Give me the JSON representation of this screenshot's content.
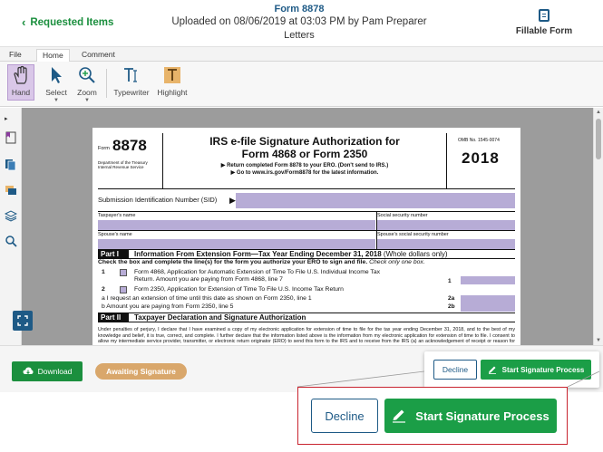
{
  "header": {
    "back_label": "Requested Items",
    "form_name": "Form 8878",
    "uploaded": "Uploaded on 08/06/2019 at 03:03 PM by Pam Preparer",
    "category": "Letters",
    "fillable_label": "Fillable Form"
  },
  "menubar": {
    "tabs": [
      "File",
      "Home",
      "Comment"
    ]
  },
  "toolbar": {
    "hand": "Hand",
    "select": "Select",
    "zoom": "Zoom",
    "typewriter": "Typewriter",
    "highlight": "Highlight"
  },
  "form": {
    "form_prefix": "Form",
    "form_number": "8878",
    "dept": "Department of the Treasury Internal Revenue Service",
    "title_line1": "IRS e-file Signature Authorization for",
    "title_line2": "Form 4868 or Form 2350",
    "instr1": "▶ Return completed Form 8878 to your ERO. (Don't send to IRS.)",
    "instr2": "▶ Go to www.irs.gov/Form8878 for the latest information.",
    "omb": "OMB No. 1545-0074",
    "year": "2018",
    "sid_label": "Submission Identification Number (SID)",
    "taxpayer_name": "Taxpayer's name",
    "ssn": "Social security number",
    "spouse_name": "Spouse's name",
    "spouse_ssn": "Spouse's social security number",
    "part1_label": "Part I",
    "part1_title": "Information From Extension Form—Tax Year Ending December 31, 2018",
    "part1_suffix": "(Whole dollars only)",
    "part1_instr": "Check the box and complete the line(s) for the form you authorize your ERO to sign and file.",
    "part1_instr_italic": "Check only one box.",
    "line1_no": "1",
    "line1_text": "Form 4868, Application for Automatic Extension of Time To File U.S. Individual Income Tax",
    "line1_text2": "Return. Amount you are paying from Form 4868, line 7",
    "line1_box": "1",
    "line2_no": "2",
    "line2_text": "Form 2350, Application for Extension of Time To File U.S. Income Tax Return",
    "line2a": "a   I request an extension of time until this date as shown on Form 2350, line 1",
    "line2a_box": "2a",
    "line2b": "b   Amount you are paying from Form 2350, line 5",
    "line2b_box": "2b",
    "part2_label": "Part II",
    "part2_title": "Taxpayer Declaration and Signature Authorization",
    "penalties": "Under penalties of perjury, I declare that I have examined a copy of my electronic application for extension of time to file for the tax year ending December 31, 2018, and to the best of my knowledge and belief, it is true, correct, and complete. I further declare that the information listed above is the information from my electronic application for extension of time to file. I consent to allow my intermediate service provider, transmitter, or electronic return originator (ERO) to send this form to the IRS and to receive from the IRS (a) an acknowledgement of receipt or reason for rejection of the transmission and (b) the reason for any delay in processing the form. If applicable, I authorize the U.S. Treasury and its designated Financial Agent to initiate an ACH electronic funds withdrawal (direct debit) entry to the financial institution account indicated in the tax preparation software for payment of my federal taxes owed on this return and/or payment of"
  },
  "bottom": {
    "download": "Download",
    "status": "Awaiting Signature",
    "decline": "Decline",
    "start": "Start Signature Process"
  },
  "colors": {
    "green": "#1b9e47",
    "blue": "#1e5a86",
    "purple_fill": "#b7acd6",
    "callout_red": "#c8242f",
    "awaiting": "#d9a76b"
  }
}
